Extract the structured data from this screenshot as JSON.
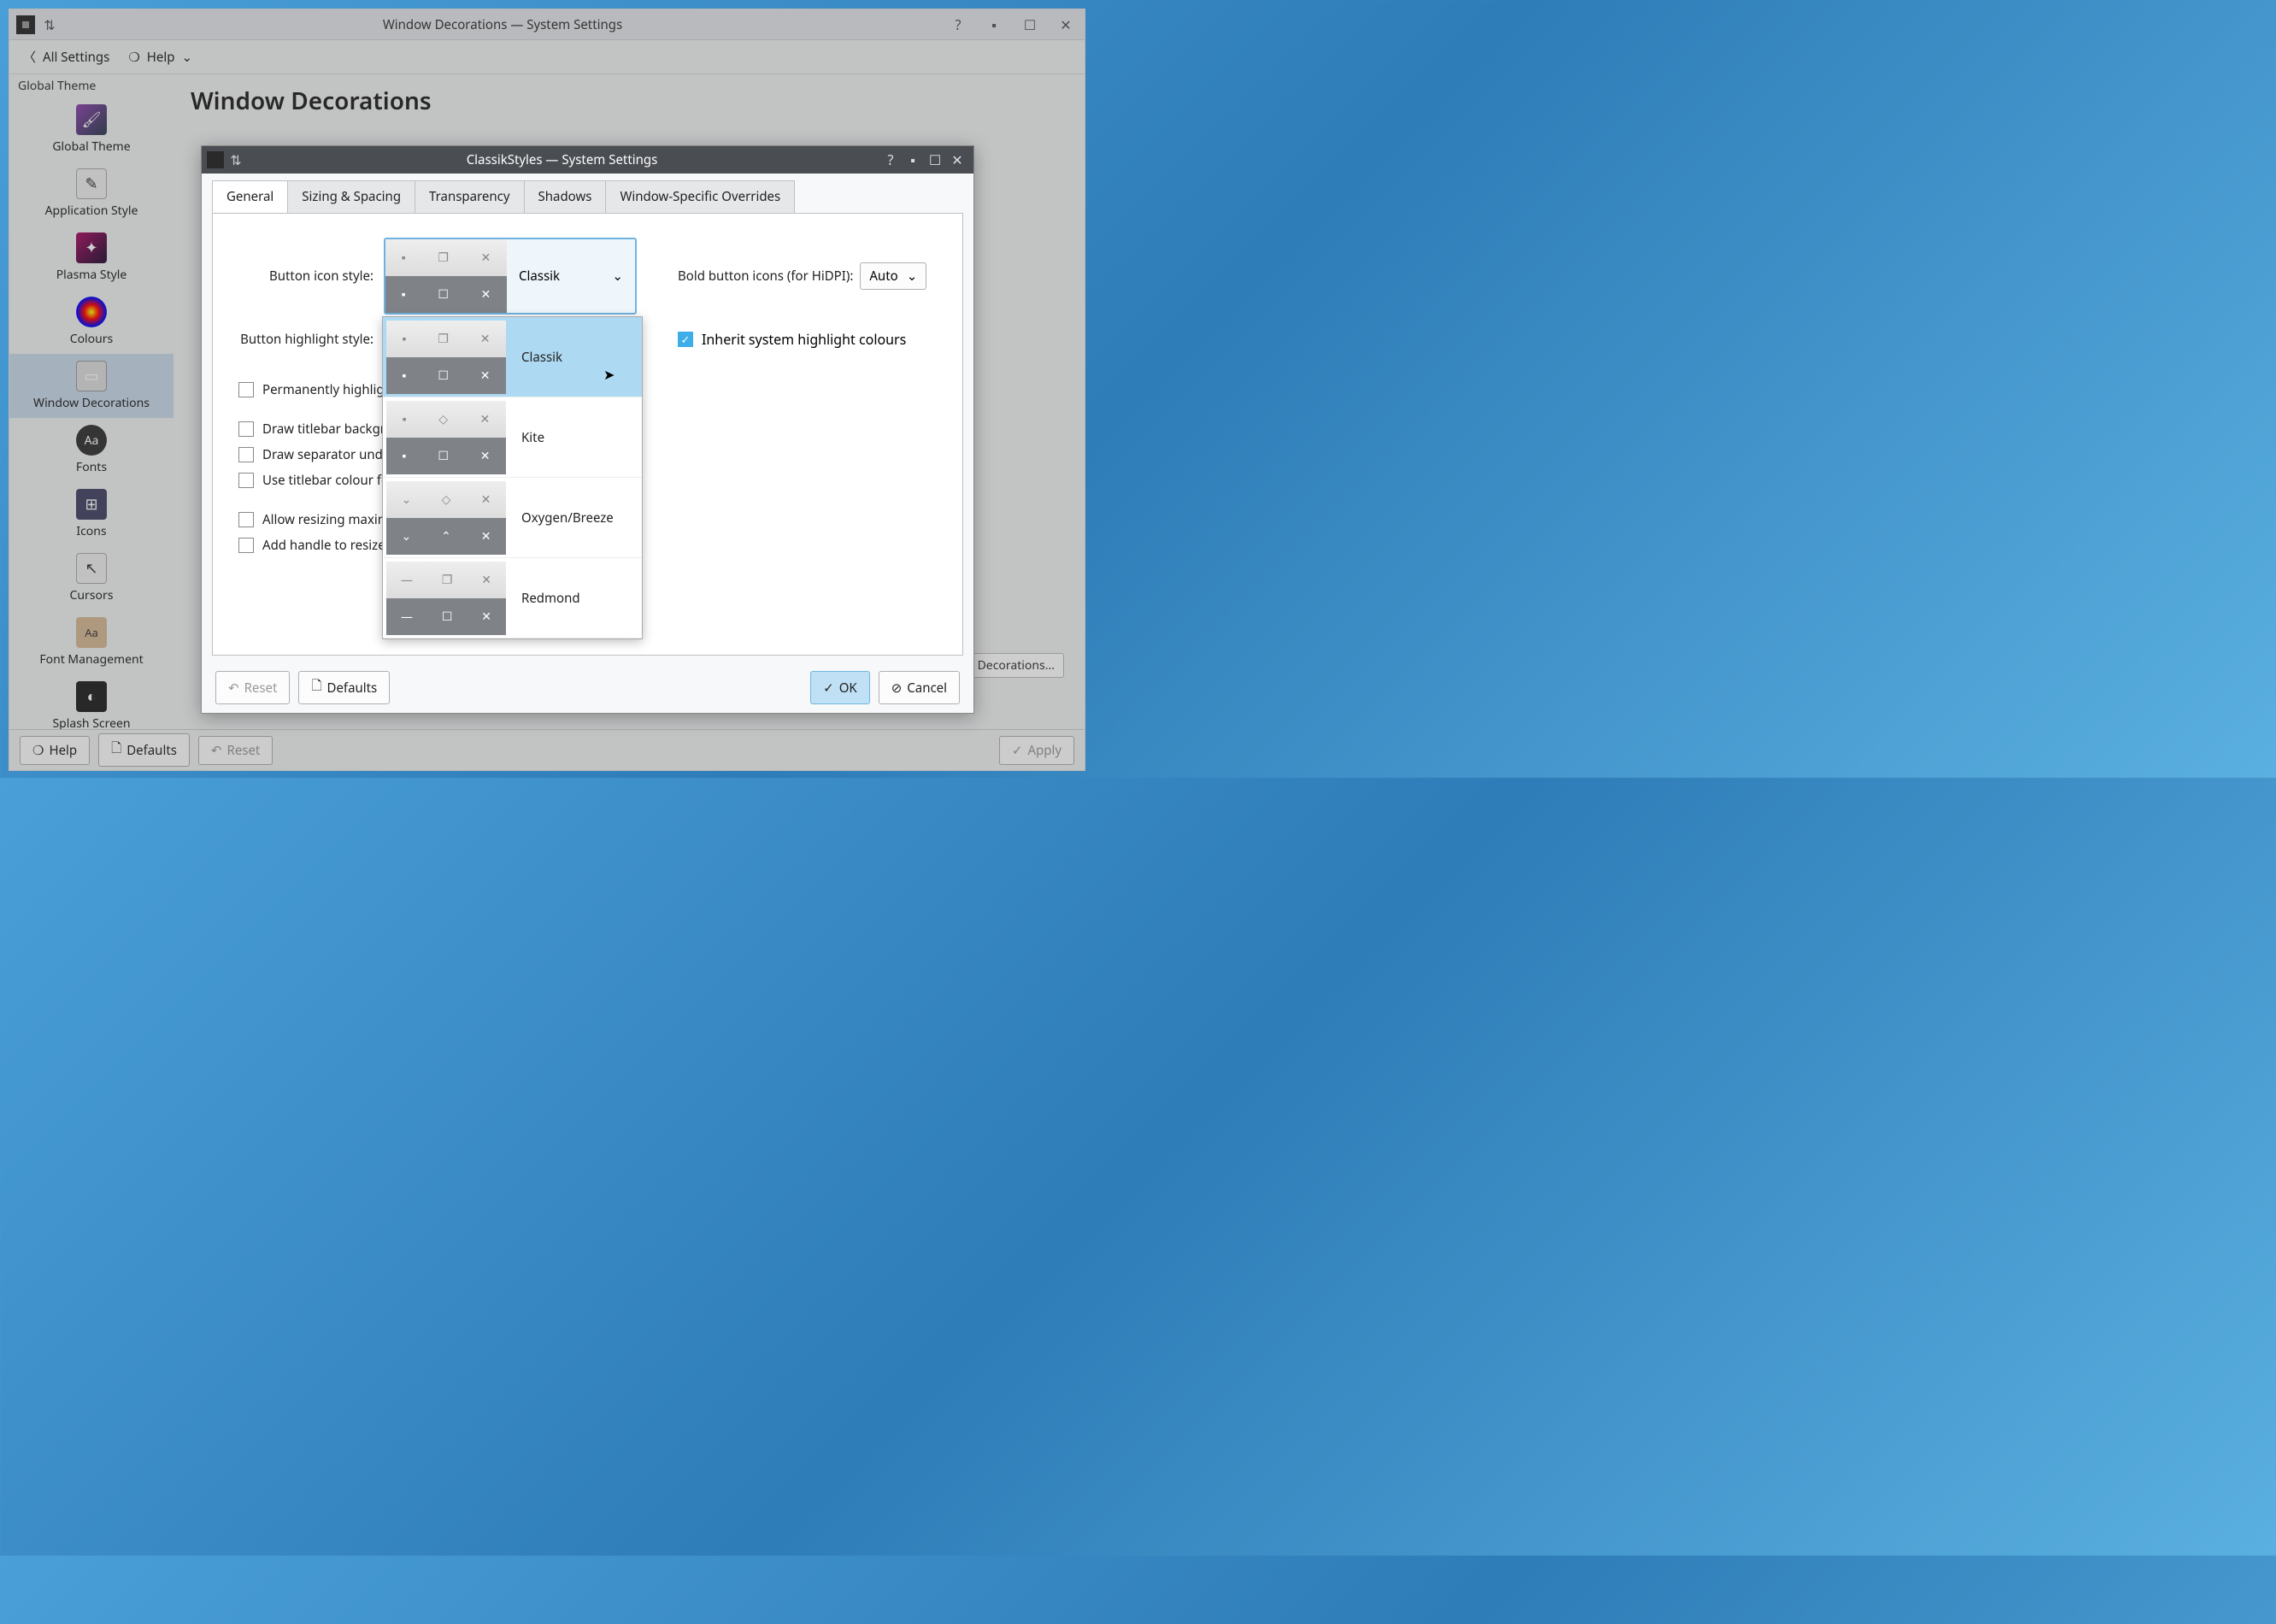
{
  "main_titlebar": {
    "title": "Window Decorations — System Settings"
  },
  "toolbar": {
    "back": "All Settings",
    "help": "Help"
  },
  "sidebar": {
    "top_label": "Global Theme",
    "items": [
      {
        "label": "Global Theme"
      },
      {
        "label": "Application Style"
      },
      {
        "label": "Plasma Style"
      },
      {
        "label": "Colours"
      },
      {
        "label": "Window Decorations"
      },
      {
        "label": "Fonts"
      },
      {
        "label": "Icons"
      },
      {
        "label": "Cursors"
      },
      {
        "label": "Font Management"
      },
      {
        "label": "Splash Screen"
      }
    ]
  },
  "page": {
    "title": "Window Decorations",
    "get_new": "Decorations..."
  },
  "bottom": {
    "help": "Help",
    "defaults": "Defaults",
    "reset": "Reset",
    "apply": "Apply"
  },
  "dialog": {
    "title": "ClassikStyles — System Settings",
    "tabs": [
      "General",
      "Sizing & Spacing",
      "Transparency",
      "Shadows",
      "Window-Specific Overrides"
    ],
    "labels": {
      "button_icon_style": "Button icon style:",
      "button_highlight_style": "Button highlight style:",
      "bold_icons": "Bold button icons (for HiDPI):",
      "inherit": "Inherit system highlight colours"
    },
    "icon_style_value": "Classik",
    "bold_value": "Auto",
    "checkboxes": {
      "perm_highlight": "Permanently highligh",
      "draw_bg": "Draw titlebar backgro",
      "draw_sep": "Draw separator unde",
      "use_colour": "Use titlebar colour fo",
      "allow_resize": "Allow resizing maxim",
      "add_handle": "Add handle to resize"
    },
    "buttons": {
      "reset": "Reset",
      "defaults": "Defaults",
      "ok": "OK",
      "cancel": "Cancel"
    }
  },
  "dropdown": {
    "options": [
      {
        "label": "Classik"
      },
      {
        "label": "Kite"
      },
      {
        "label": "Oxygen/Breeze"
      },
      {
        "label": "Redmond"
      }
    ]
  }
}
